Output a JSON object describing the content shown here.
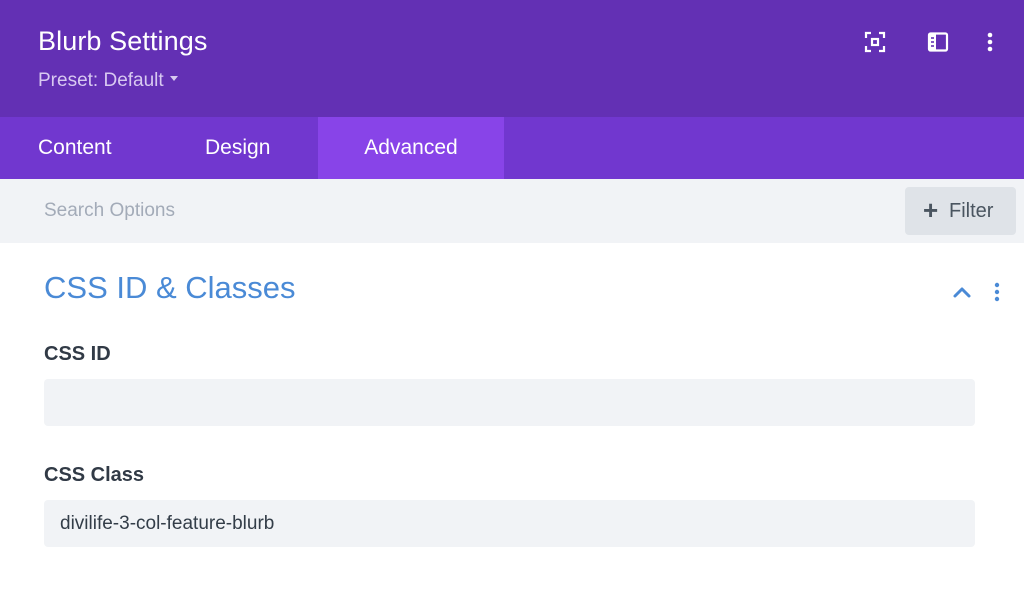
{
  "header": {
    "title": "Blurb Settings",
    "preset_label": "Preset: Default",
    "icons": [
      "expand-icon",
      "split-view-icon",
      "more-vertical-icon"
    ],
    "background": "#6330b4"
  },
  "tabs": [
    {
      "label": "Content",
      "active": false
    },
    {
      "label": "Design",
      "active": false
    },
    {
      "label": "Advanced",
      "active": true
    }
  ],
  "search": {
    "placeholder": "Search Options",
    "value": ""
  },
  "filter_button": {
    "label": "Filter",
    "icon": "plus-icon"
  },
  "section": {
    "title": "CSS ID & Classes",
    "expanded": true,
    "accent_color": "#4a8ad6"
  },
  "fields": {
    "css_id": {
      "label": "CSS ID",
      "value": ""
    },
    "css_class": {
      "label": "CSS Class",
      "value": "divilife-3-col-feature-blurb"
    }
  }
}
